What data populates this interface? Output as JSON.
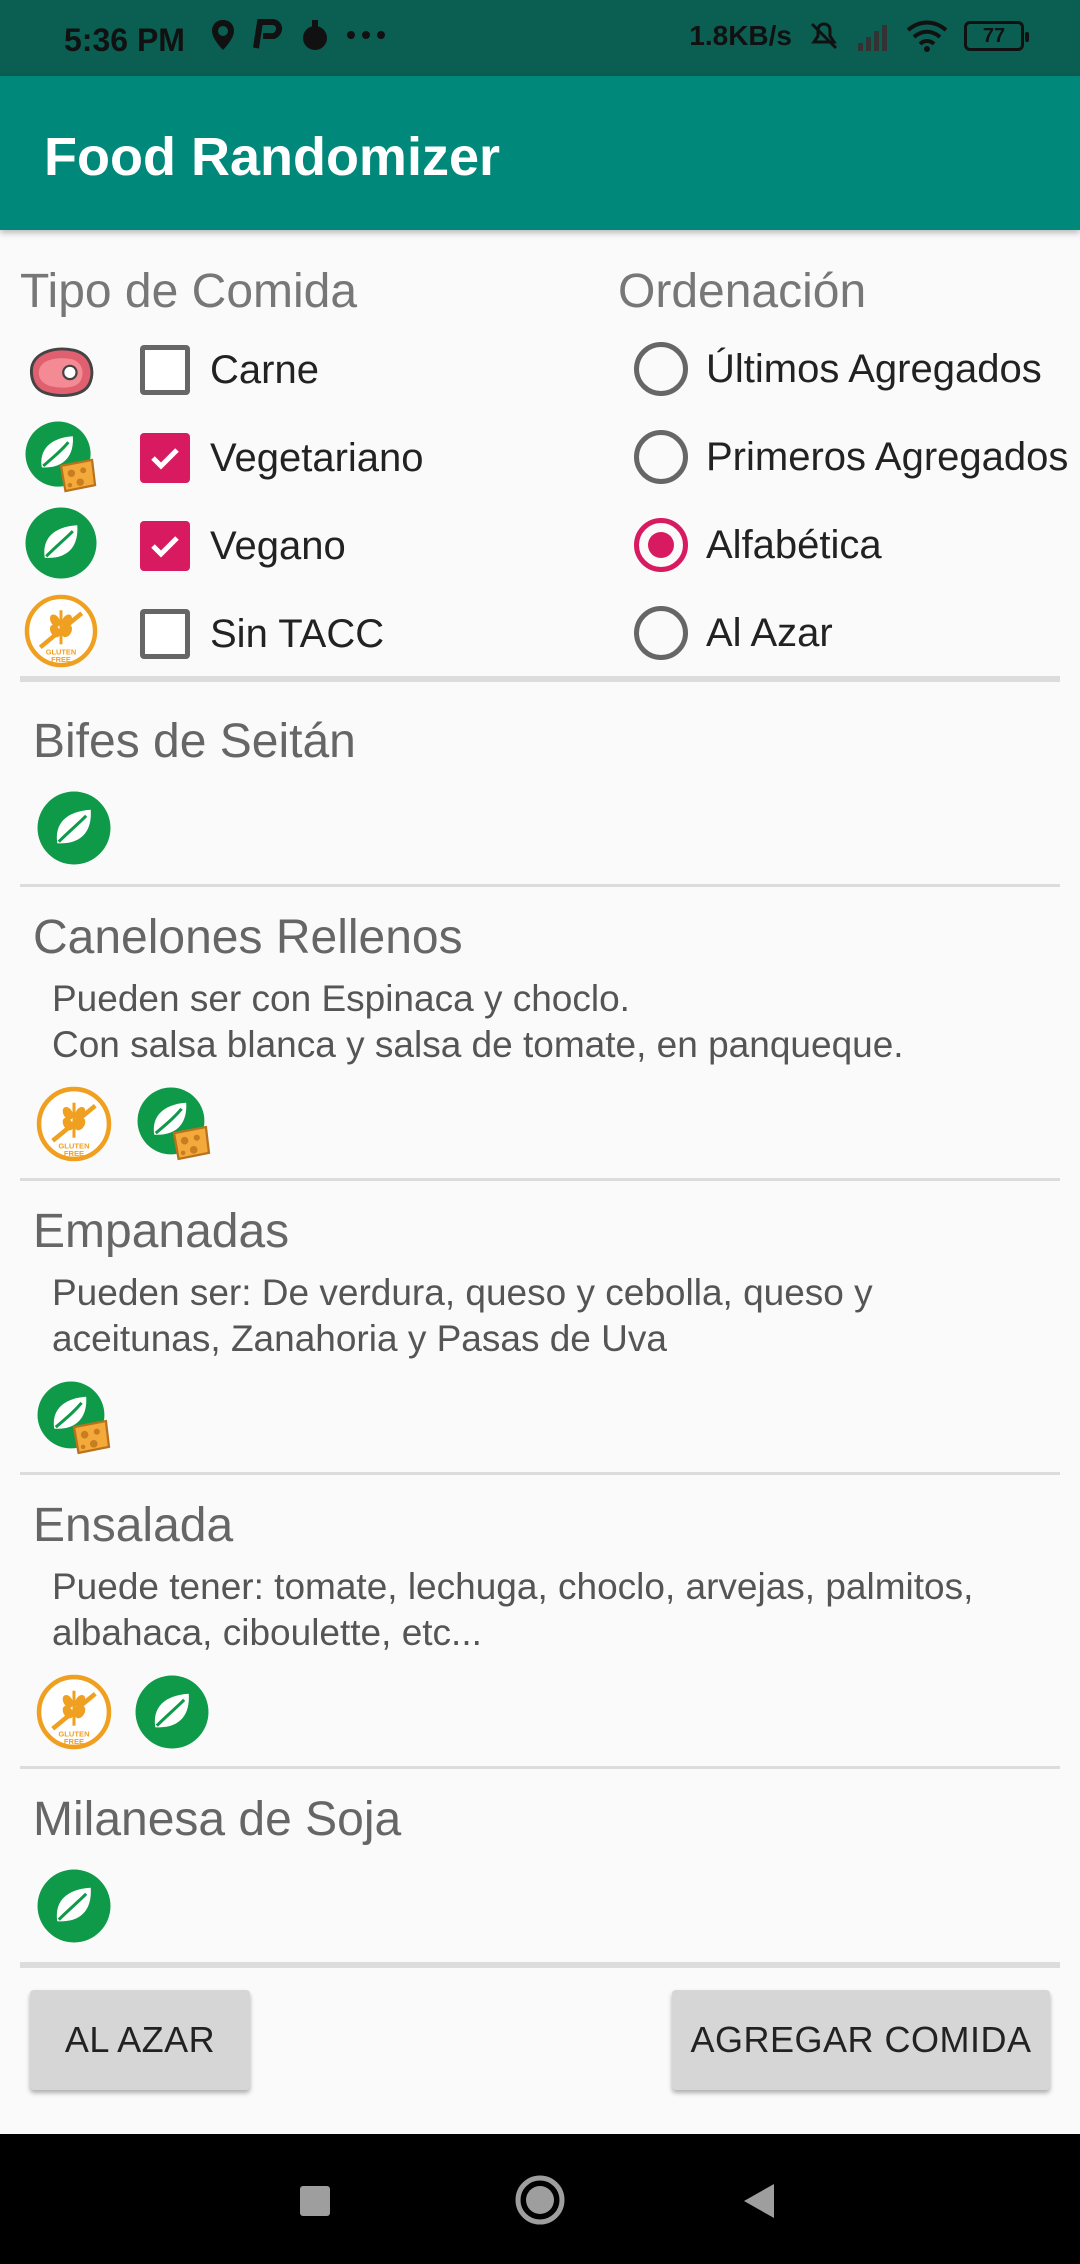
{
  "status": {
    "time": "5:36 PM",
    "speed": "1.8KB/s",
    "battery": "77"
  },
  "app": {
    "title": "Food Randomizer"
  },
  "filters": {
    "title": "Tipo de Comida",
    "items": [
      {
        "label": "Carne",
        "checked": false,
        "icon": "meat-icon"
      },
      {
        "label": "Vegetariano",
        "checked": true,
        "icon": "vegetarian-icon"
      },
      {
        "label": "Vegano",
        "checked": true,
        "icon": "vegan-icon"
      },
      {
        "label": "Sin TACC",
        "checked": false,
        "icon": "gluten-free-icon"
      }
    ]
  },
  "sorting": {
    "title": "Ordenación",
    "options": [
      {
        "label": "Últimos Agregados",
        "selected": false
      },
      {
        "label": "Primeros Agregados",
        "selected": false
      },
      {
        "label": "Alfabética",
        "selected": true
      },
      {
        "label": "Al Azar",
        "selected": false
      }
    ]
  },
  "foods": [
    {
      "name": "Bifes de Seitán",
      "desc1": "",
      "desc2": "",
      "icons": [
        "vegan-icon"
      ]
    },
    {
      "name": "Canelones Rellenos",
      "desc1": "Pueden ser con Espinaca y choclo.",
      "desc2": "Con salsa blanca y salsa de tomate, en panqueque.",
      "icons": [
        "gluten-free-icon",
        "vegetarian-icon"
      ]
    },
    {
      "name": "Empanadas",
      "desc1": "Pueden ser: De verdura, queso y cebolla, queso y",
      "desc2": "aceitunas, Zanahoria y Pasas de Uva",
      "icons": [
        "vegetarian-icon"
      ]
    },
    {
      "name": "Ensalada",
      "desc1": "Puede tener: tomate, lechuga, choclo, arvejas, palmitos,",
      "desc2": "albahaca, ciboulette, etc...",
      "icons": [
        "gluten-free-icon",
        "vegan-icon"
      ]
    },
    {
      "name": "Milanesa de Soja",
      "desc1": "",
      "desc2": "",
      "icons": [
        "vegan-icon"
      ]
    }
  ],
  "buttons": {
    "random": "AL AZAR",
    "add": "AGREGAR COMIDA"
  },
  "icon_text": {
    "gluten": "GLUTEN",
    "free": "FREE"
  },
  "colors": {
    "primary": "#00897b",
    "accent": "#d81b60",
    "vegan": "#0e9a48",
    "gluten": "#f0a020"
  }
}
